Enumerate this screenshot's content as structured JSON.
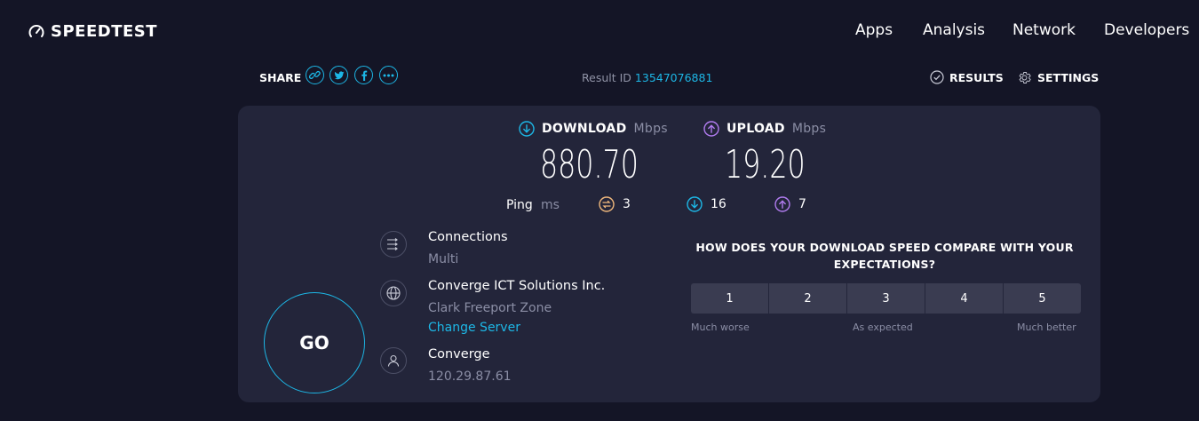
{
  "header": {
    "logo_text": "SPEEDTEST",
    "nav": [
      "Apps",
      "Analysis",
      "Network",
      "Developers"
    ]
  },
  "toolbar": {
    "share_label": "SHARE",
    "share_icons": [
      "link-icon",
      "twitter-icon",
      "facebook-icon",
      "more-icon"
    ],
    "result_id_label": "Result ID",
    "result_id": "13547076881",
    "results_label": "RESULTS",
    "settings_label": "SETTINGS"
  },
  "speed": {
    "download_label": "DOWNLOAD",
    "download_unit": "Mbps",
    "download_value": "880.70",
    "upload_label": "UPLOAD",
    "upload_unit": "Mbps",
    "upload_value": "19.20"
  },
  "ping": {
    "label": "Ping",
    "unit": "ms",
    "idle": "3",
    "download": "16",
    "upload": "7"
  },
  "go_label": "GO",
  "info": {
    "connections_title": "Connections",
    "connections_value": "Multi",
    "server_title": "Converge ICT Solutions Inc.",
    "server_location": "Clark Freeport Zone",
    "change_server": "Change Server",
    "isp_title": "Converge",
    "ip_address": "120.29.87.61"
  },
  "rating": {
    "question": "HOW DOES YOUR DOWNLOAD SPEED COMPARE WITH YOUR EXPECTATIONS?",
    "options": [
      "1",
      "2",
      "3",
      "4",
      "5"
    ],
    "low_label": "Much worse",
    "mid_label": "As expected",
    "high_label": "Much better"
  },
  "colors": {
    "background": "#141526",
    "card": "#23253a",
    "accent": "#1db7e6",
    "upload": "#b17cf0",
    "ping": "#f0b87c"
  }
}
